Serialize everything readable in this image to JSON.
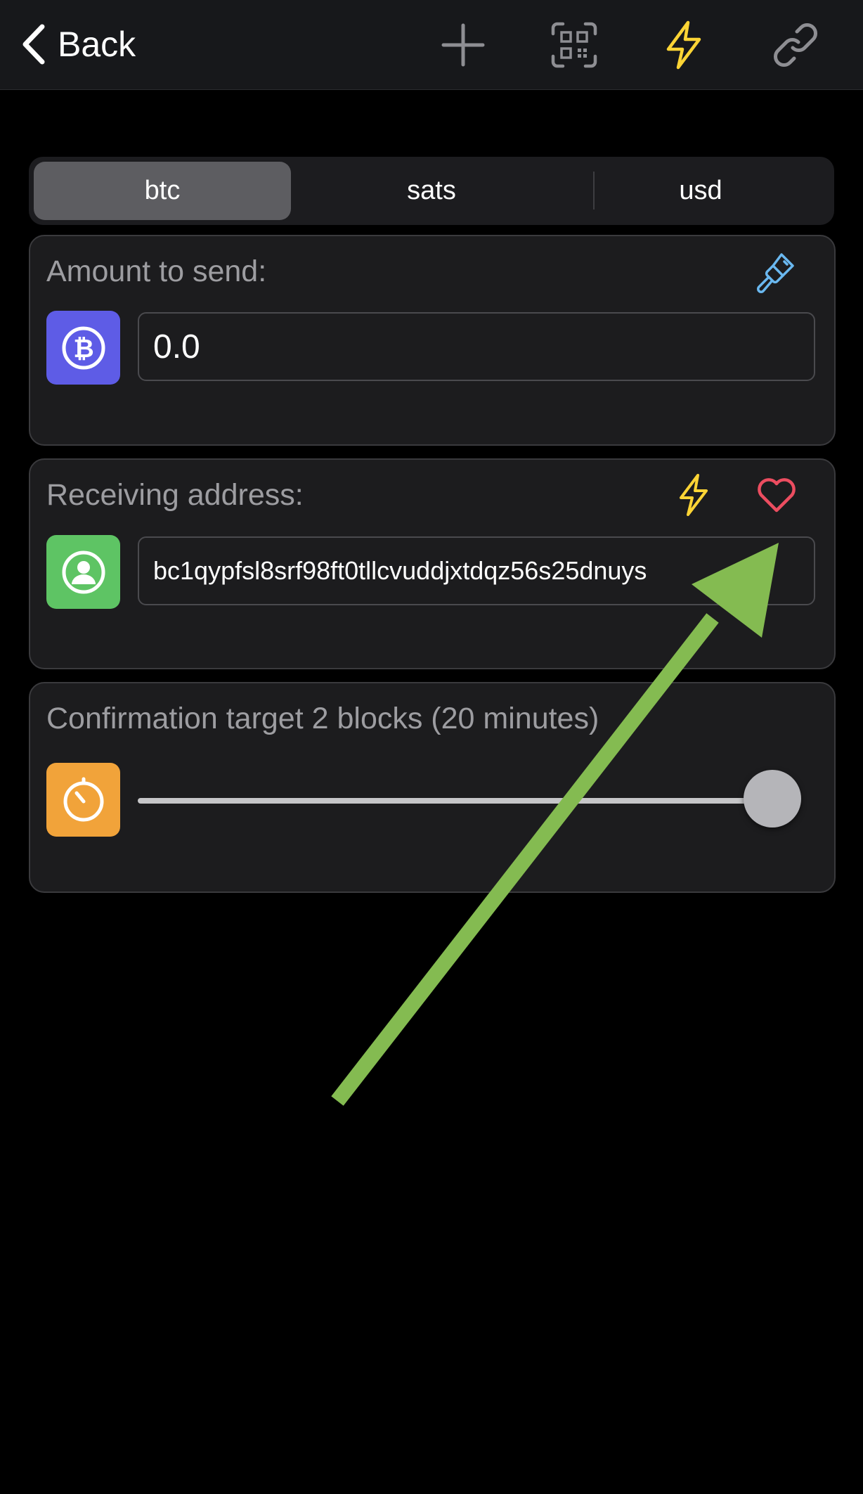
{
  "nav": {
    "back_label": "Back",
    "icons": [
      "plus-icon",
      "qr-scan-icon",
      "lightning-icon",
      "link-icon"
    ]
  },
  "units": {
    "options": [
      "btc",
      "sats",
      "usd"
    ],
    "selected": "btc"
  },
  "amount": {
    "label": "Amount to send:",
    "value": "0.0",
    "badge_icon": "bitcoin-icon",
    "action_icon": "paintbrush-icon"
  },
  "receiving": {
    "label": "Receiving address:",
    "address": "bc1qypfsl8srf98ft0tllcvuddjxtdqz56s25dnuys",
    "badge_icon": "contact-icon",
    "action_icons": [
      "lightning-icon",
      "heart-icon"
    ]
  },
  "confirmation": {
    "label": "Confirmation target 2 blocks (20 minutes)",
    "slider_fraction": 1.0,
    "badge_icon": "timer-icon"
  },
  "colors": {
    "bitcoin_badge": "#5e5ce6",
    "contact_badge": "#5ec464",
    "timer_badge": "#f1a33a",
    "lightning": "#fcd435",
    "heart": "#ec4d60",
    "brush": "#6ab8f0",
    "arrow": "#84bb51"
  }
}
